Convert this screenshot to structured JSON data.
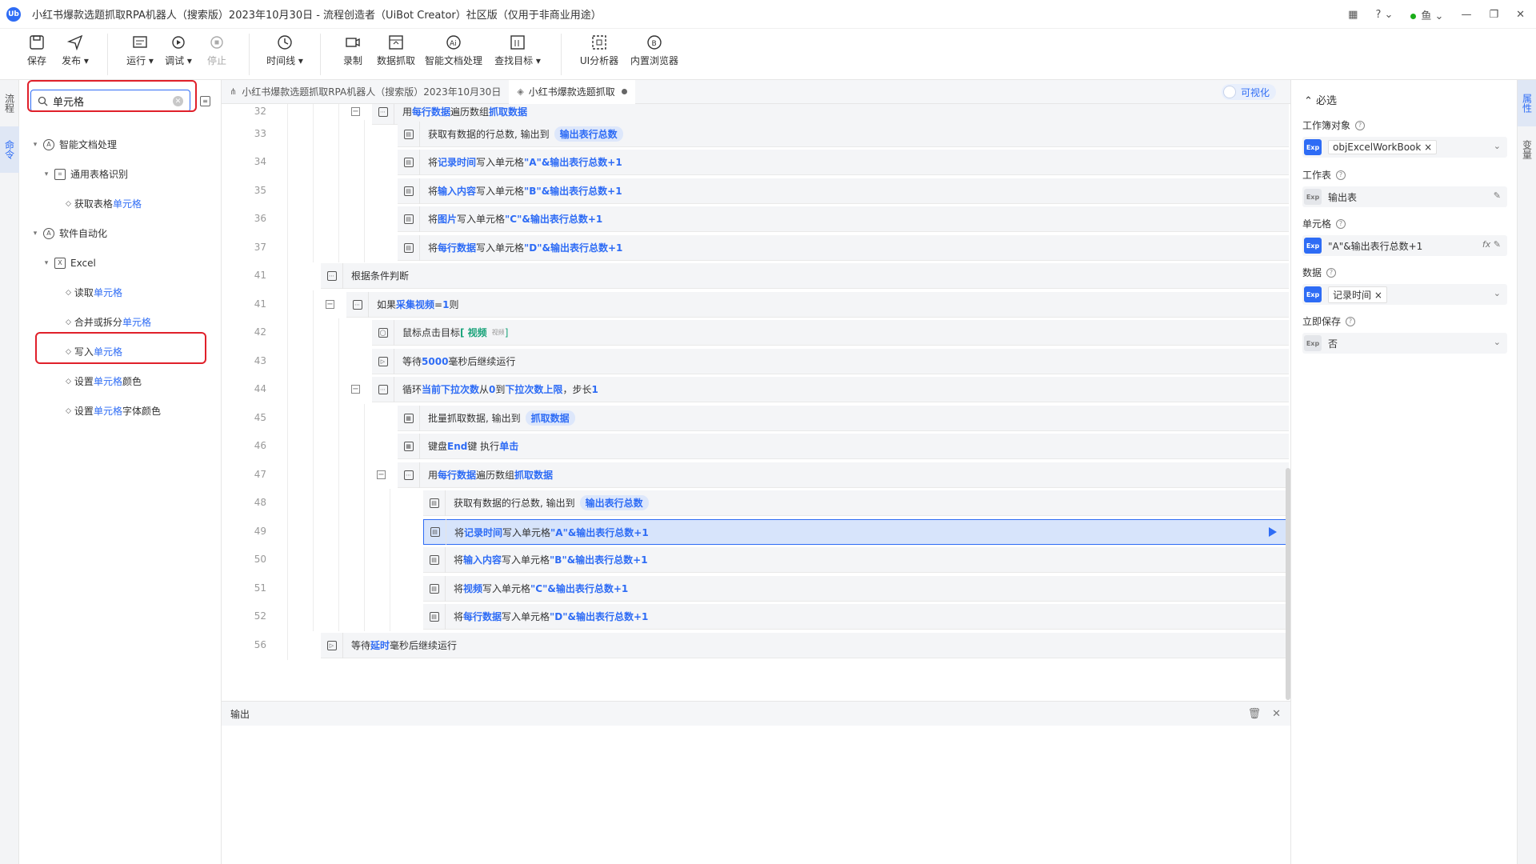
{
  "titlebar": {
    "logo": "Ub",
    "title": "小红书爆款选题抓取RPA机器人（搜索版）2023年10月30日 - 流程创造者（UiBot Creator）社区版（仅用于非商业用途）",
    "user": "鱼"
  },
  "toolbar": {
    "save": "保存",
    "publish": "发布",
    "run": "运行",
    "debug": "调试",
    "stop": "停止",
    "timeline": "时间线",
    "record": "录制",
    "data_scrape": "数据抓取",
    "smart_doc": "智能文档处理",
    "find_target": "查找目标",
    "ui_analyzer": "UI分析器",
    "builtin_browser": "内置浏览器"
  },
  "left_strip": {
    "tab1": "流程",
    "tab2": "命令"
  },
  "left_panel": {
    "search_value": "单元格",
    "tree": [
      {
        "label": "智能文档处理",
        "hl": ""
      },
      {
        "label": "通用表格识别",
        "hl": ""
      },
      {
        "label": "获取表格",
        "hl": "单元格"
      },
      {
        "label": "软件自动化",
        "hl": ""
      },
      {
        "label": "Excel",
        "hl": ""
      },
      {
        "label": "读取",
        "hl": "单元格"
      },
      {
        "label": "合并或拆分",
        "hl": "单元格"
      },
      {
        "label": "写入",
        "hl": "单元格"
      },
      {
        "label": "设置",
        "hl": "单元格",
        "suffix": "颜色"
      },
      {
        "label": "设置",
        "hl": "单元格",
        "suffix": "字体颜色"
      }
    ]
  },
  "tabs": {
    "tab1": "小红书爆款选题抓取RPA机器人（搜索版）2023年10月30日",
    "tab2": "小红书爆款选题抓取",
    "visual_toggle": "可视化"
  },
  "lines": [
    {
      "n": "32",
      "t": [
        "用 ",
        "每行数据",
        " 遍历数组 ",
        "抓取数据"
      ]
    },
    {
      "n": "33",
      "t": [
        "获取有数据的行总数, 输出到 ",
        "输出表行总数"
      ]
    },
    {
      "n": "34",
      "t": [
        "将 ",
        "记录时间",
        " 写入单元格 ",
        "\"A\"&输出表行总数+1"
      ]
    },
    {
      "n": "35",
      "t": [
        "将 ",
        "输入内容",
        " 写入单元格 ",
        "\"B\"&输出表行总数+1"
      ]
    },
    {
      "n": "36",
      "t": [
        "将 ",
        "图片",
        " 写入单元格 ",
        "\"C\"&输出表行总数+1"
      ]
    },
    {
      "n": "37",
      "t": [
        "将 ",
        "每行数据",
        " 写入单元格 ",
        "\"D\"&输出表行总数+1"
      ]
    },
    {
      "n": "41",
      "t": [
        "根据条件判断"
      ]
    },
    {
      "n": "41",
      "t": [
        "如果 ",
        "采集视频",
        " = ",
        "1",
        " 则"
      ]
    },
    {
      "n": "42",
      "t": [
        "鼠标点击目标 ",
        "[ 视频",
        "视频",
        " ]"
      ]
    },
    {
      "n": "43",
      "t": [
        "等待 ",
        "5000",
        " 毫秒后继续运行"
      ]
    },
    {
      "n": "44",
      "t": [
        "循环 ",
        "当前下拉次数",
        " 从 ",
        "0",
        " 到 ",
        "下拉次数上限",
        " ，步长 ",
        "1"
      ]
    },
    {
      "n": "45",
      "t": [
        "批量抓取数据, 输出到 ",
        "抓取数据"
      ]
    },
    {
      "n": "46",
      "t": [
        "键盘 ",
        "End",
        " 键 执行 ",
        "单击"
      ]
    },
    {
      "n": "47",
      "t": [
        "用 ",
        "每行数据",
        " 遍历数组 ",
        "抓取数据"
      ]
    },
    {
      "n": "48",
      "t": [
        "获取有数据的行总数, 输出到 ",
        "输出表行总数"
      ]
    },
    {
      "n": "49",
      "t": [
        "将 ",
        "记录时间",
        " 写入单元格 ",
        "\"A\"&输出表行总数+1"
      ]
    },
    {
      "n": "50",
      "t": [
        "将 ",
        "输入内容",
        " 写入单元格 ",
        "\"B\"&输出表行总数+1"
      ]
    },
    {
      "n": "51",
      "t": [
        "将 ",
        "视频",
        " 写入单元格 ",
        "\"C\"&输出表行总数+1"
      ]
    },
    {
      "n": "52",
      "t": [
        "将 ",
        "每行数据",
        " 写入单元格 ",
        "\"D\"&输出表行总数+1"
      ]
    },
    {
      "n": "56",
      "t": [
        "等待 ",
        "延时",
        " 毫秒后继续运行"
      ]
    }
  ],
  "output": {
    "tab": "输出"
  },
  "right_panel": {
    "section": "必选",
    "workbook_label": "工作簿对象",
    "workbook_value": "objExcelWorkBook",
    "sheet_label": "工作表",
    "sheet_value": "输出表",
    "cell_label": "单元格",
    "cell_value": "\"A\"&输出表行总数+1",
    "data_label": "数据",
    "data_value": "记录时间",
    "save_label": "立即保存",
    "save_value": "否",
    "exp": "Exp",
    "fx": "fx"
  },
  "right_strip": {
    "tab1": "属性",
    "tab2": "变量"
  }
}
